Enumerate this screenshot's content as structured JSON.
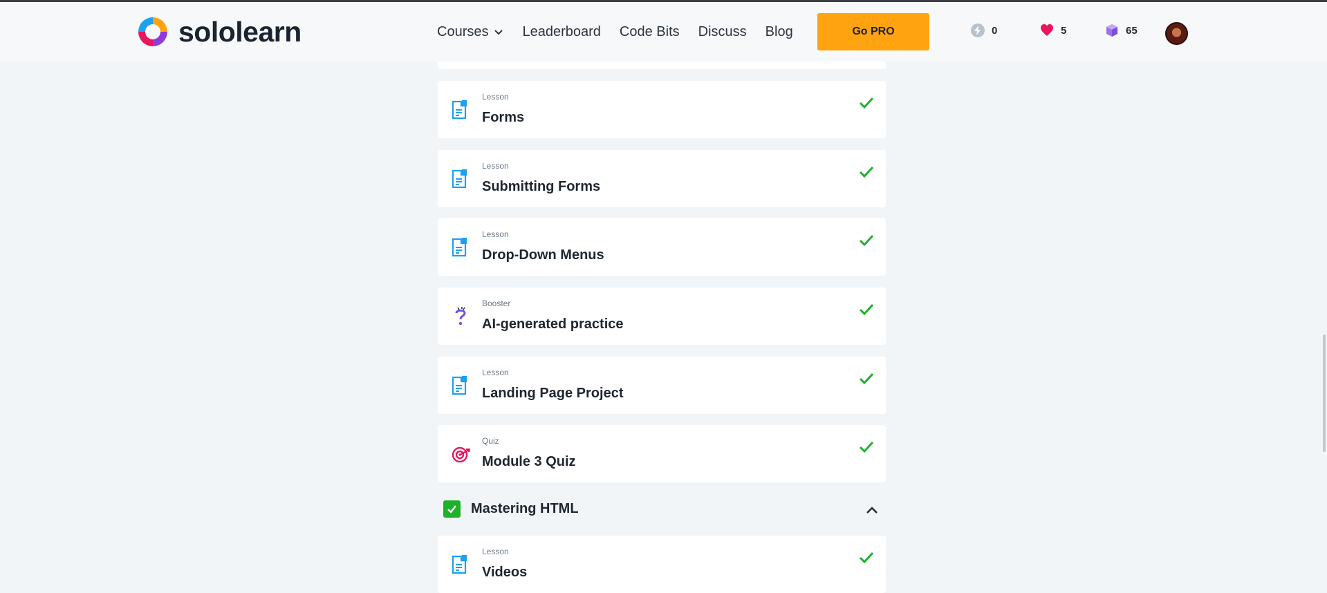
{
  "header": {
    "brand": "sololearn",
    "nav": {
      "courses": "Courses",
      "leaderboard": "Leaderboard",
      "code_bits": "Code Bits",
      "discuss": "Discuss",
      "blog": "Blog"
    },
    "go_pro": "Go PRO",
    "stats": {
      "streak": "0",
      "hearts": "5",
      "gems": "65"
    }
  },
  "lessons": [
    {
      "type": "Lesson",
      "title": "Forms",
      "icon": "lesson-icon",
      "completed": true
    },
    {
      "type": "Lesson",
      "title": "Submitting Forms",
      "icon": "lesson-icon",
      "completed": true
    },
    {
      "type": "Lesson",
      "title": "Drop-Down Menus",
      "icon": "lesson-icon",
      "completed": true
    },
    {
      "type": "Booster",
      "title": "AI-generated practice",
      "icon": "booster-icon",
      "completed": true
    },
    {
      "type": "Lesson",
      "title": "Landing Page Project",
      "icon": "lesson-icon",
      "completed": true
    },
    {
      "type": "Quiz",
      "title": "Module 3 Quiz",
      "icon": "quiz-icon",
      "completed": true
    }
  ],
  "module": {
    "title": "Mastering HTML",
    "completed": true,
    "expanded": true
  },
  "module_lessons": [
    {
      "type": "Lesson",
      "title": "Videos",
      "icon": "lesson-icon",
      "completed": true
    }
  ],
  "colors": {
    "accent_orange": "#ffa310",
    "check_green": "#1eb12c",
    "lesson_blue": "#1ea0f0",
    "quiz_pink": "#e8175d",
    "booster_purple": "#7a4ed9"
  }
}
